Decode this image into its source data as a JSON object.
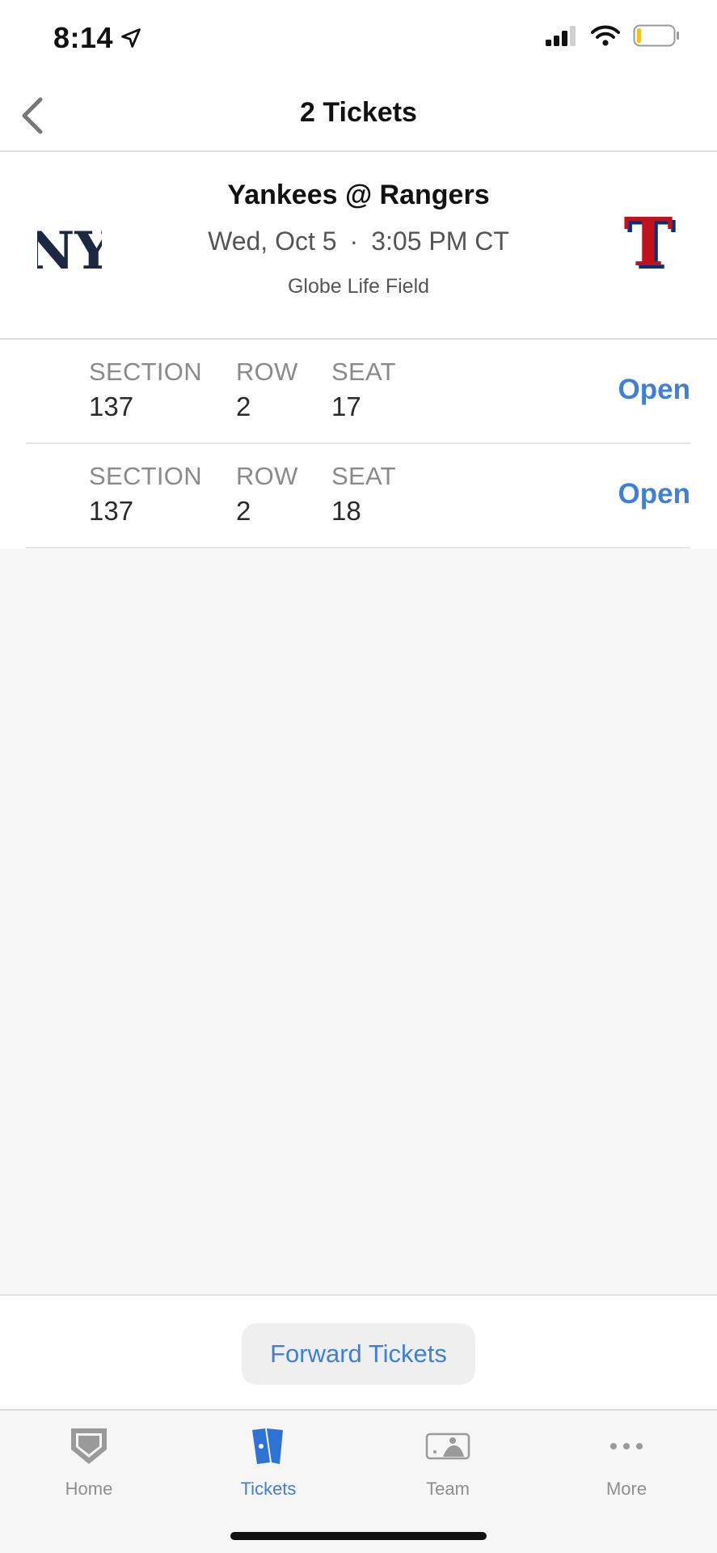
{
  "status_bar": {
    "time": "8:14"
  },
  "nav": {
    "title": "2 Tickets"
  },
  "event": {
    "title": "Yankees @ Rangers",
    "date": "Wed, Oct 5",
    "separator": "·",
    "time": "3:05 PM CT",
    "venue": "Globe Life Field",
    "away_logo_text": "NY",
    "home_logo_text": "T"
  },
  "tickets": [
    {
      "section_label": "SECTION",
      "section": "137",
      "row_label": "ROW",
      "row": "2",
      "seat_label": "SEAT",
      "seat": "17",
      "action": "Open"
    },
    {
      "section_label": "SECTION",
      "section": "137",
      "row_label": "ROW",
      "row": "2",
      "seat_label": "SEAT",
      "seat": "18",
      "action": "Open"
    }
  ],
  "forward": {
    "label": "Forward Tickets"
  },
  "tabs": [
    {
      "label": "Home",
      "icon": "home-plate-icon"
    },
    {
      "label": "Tickets",
      "icon": "tickets-icon"
    },
    {
      "label": "Team",
      "icon": "team-icon"
    },
    {
      "label": "More",
      "icon": "more-icon"
    }
  ],
  "colors": {
    "accent": "#3f7fd9",
    "yankees_navy": "#1c2841",
    "rangers_red": "#c0111f",
    "rangers_blue": "#003278"
  }
}
